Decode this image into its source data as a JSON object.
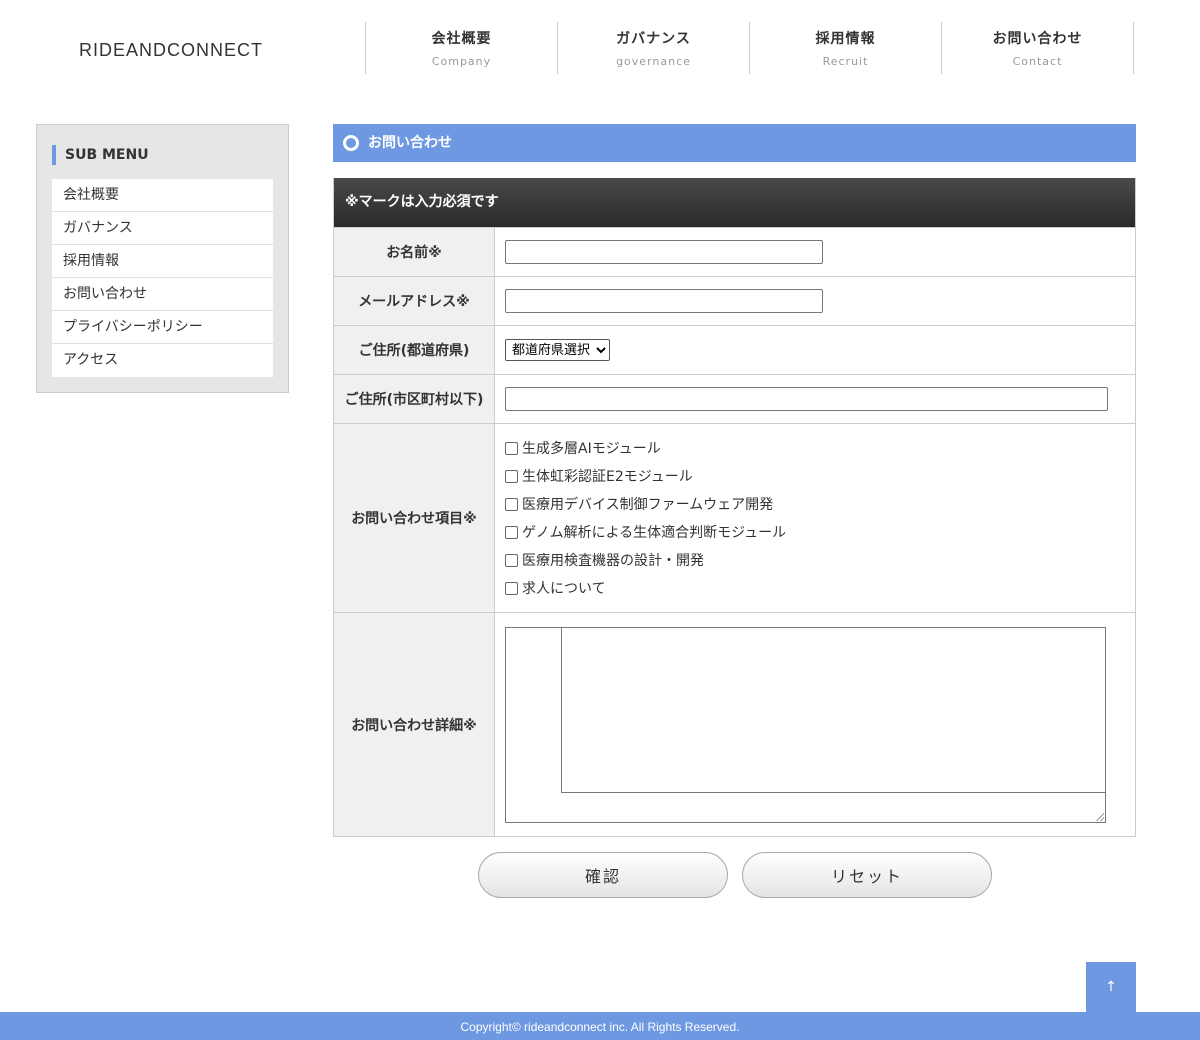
{
  "header": {
    "logo": "RIDEANDCONNECT",
    "nav": [
      {
        "jp": "会社概要",
        "en": "Company"
      },
      {
        "jp": "ガバナンス",
        "en": "governance"
      },
      {
        "jp": "採用情報",
        "en": "Recruit"
      },
      {
        "jp": "お問い合わせ",
        "en": "Contact"
      }
    ]
  },
  "sidebar": {
    "title": "SUB MENU",
    "items": [
      "会社概要",
      "ガバナンス",
      "採用情報",
      "お問い合わせ",
      "プライバシーポリシー",
      "アクセス"
    ]
  },
  "main": {
    "section_title": "お問い合わせ",
    "form_head": "※マークは入力必須です",
    "fields": {
      "name_label": "お名前※",
      "email_label": "メールアドレス※",
      "prefecture_label": "ご住所(都道府県)",
      "prefecture_selected": "都道府県選択",
      "address_label": "ご住所(市区町村以下)",
      "inquiry_label": "お問い合わせ項目※",
      "detail_label": "お問い合わせ詳細※"
    },
    "inquiry_options": [
      "生成多層AIモジュール",
      "生体虹彩認証E2モジュール",
      "医療用デバイス制御ファームウェア開発",
      "ゲノム解析による生体適合判断モジュール",
      "医療用検査機器の設計・開発",
      "求人について"
    ],
    "buttons": {
      "confirm": "確認",
      "reset": "リセット"
    }
  },
  "to_top": "↑",
  "footer": {
    "copyright": "Copyright© rideandconnect inc. All Rights Reserved."
  },
  "colors": {
    "accent": "#6f98e2",
    "form_head_bg": "#333333"
  }
}
